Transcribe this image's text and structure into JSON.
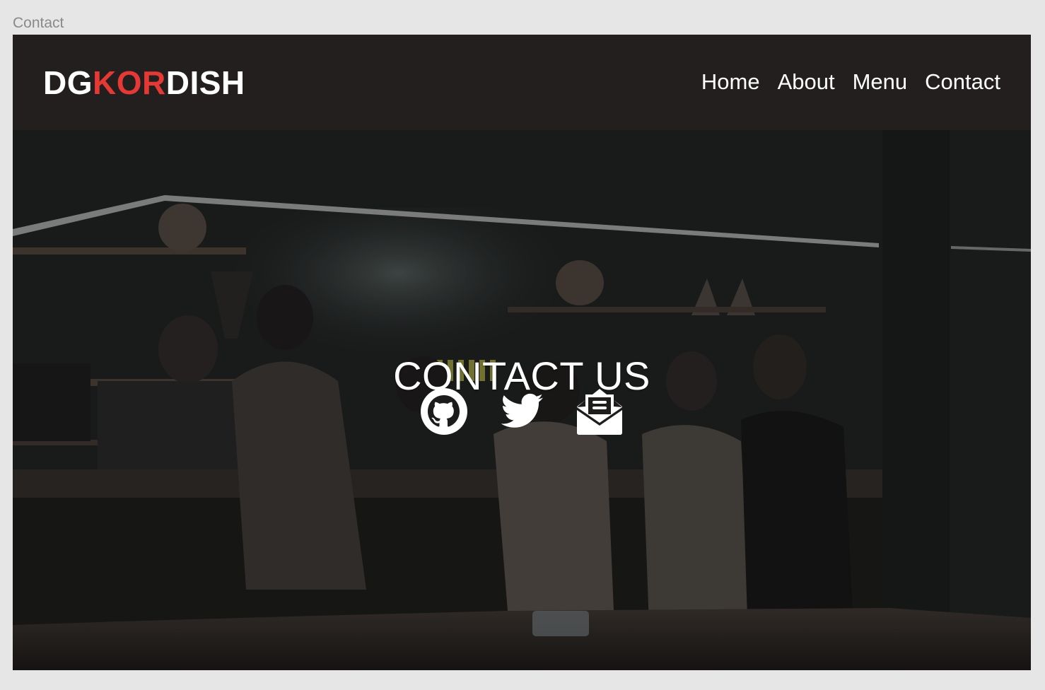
{
  "frame": {
    "label": "Contact"
  },
  "brand": {
    "part1": "DG",
    "part2": "KOR",
    "part3": "DISH",
    "accent_color": "#e53935"
  },
  "nav": {
    "items": [
      {
        "label": "Home"
      },
      {
        "label": "About"
      },
      {
        "label": "Menu"
      },
      {
        "label": "Contact"
      }
    ]
  },
  "hero": {
    "title": "CONTACT US",
    "social": [
      {
        "icon": "github-icon"
      },
      {
        "icon": "twitter-icon"
      },
      {
        "icon": "open-mail-icon"
      }
    ]
  },
  "colors": {
    "navbar_bg": "#241f1f",
    "page_bg": "#e6e6e6",
    "text": "#ffffff"
  }
}
